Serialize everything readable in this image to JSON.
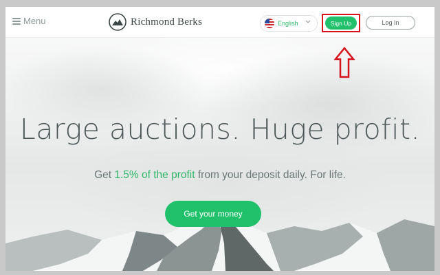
{
  "header": {
    "menu_label": "Menu",
    "brand_name": "Richmond Berks",
    "language": {
      "selected": "English",
      "flag_icon": "us-flag-icon"
    },
    "signup_label": "Sign Up",
    "login_label": "Log In"
  },
  "hero": {
    "headline": "Large auctions. Huge profit.",
    "subline": {
      "prefix": "Get ",
      "highlight": "1.5% of the profit",
      "suffix": " from your deposit daily. For life."
    },
    "cta_label": "Get your money"
  },
  "annotation": {
    "highlight_color": "#d6121a",
    "target": "Sign Up"
  },
  "colors": {
    "accent": "#21c16c",
    "accent_text": "#2fb86b",
    "text": "#4d5757"
  }
}
